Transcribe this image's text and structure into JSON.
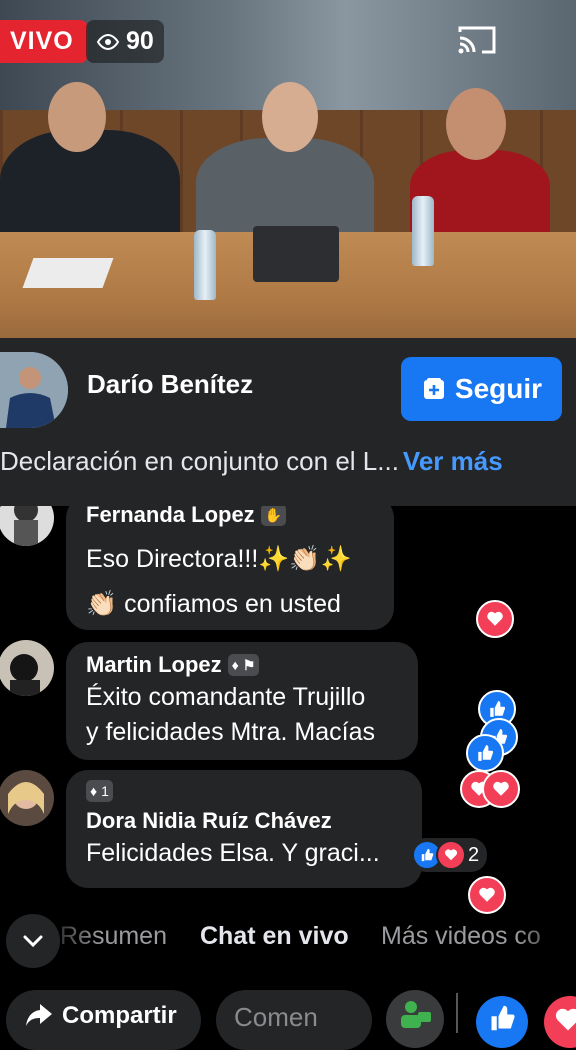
{
  "live": {
    "badge": "VIVO",
    "viewer_count": "90"
  },
  "streamer": {
    "name": "Darío Benítez",
    "follow_label": "Seguir"
  },
  "description": {
    "text": "Declaración en conjunto con el L...",
    "more": "Ver más"
  },
  "comments": [
    {
      "name": "Fernanda Lopez",
      "text_line1": "Eso Directora!!!✨👏🏻✨",
      "text_line2": "👏🏻 confiamos en usted"
    },
    {
      "name": "Martin Lopez",
      "text_line1": "Éxito comandante Trujillo",
      "text_line2": "y felicidades Mtra. Macías"
    },
    {
      "name": "Dora Nidia Ruíz Chávez",
      "badge_number": "1",
      "text_line1": "Felicidades Elsa. Y graci...",
      "reaction_count": "2"
    }
  ],
  "tabs": [
    {
      "label": "Resumen"
    },
    {
      "label": "Chat en vivo"
    },
    {
      "label": "Más videos co"
    }
  ],
  "bottom": {
    "share_label": "Compartir",
    "comment_placeholder": "Comen"
  },
  "colors": {
    "live_red": "#e4252f",
    "brand_blue": "#1877f2",
    "heart": "#f33e58",
    "surface": "#242527"
  }
}
